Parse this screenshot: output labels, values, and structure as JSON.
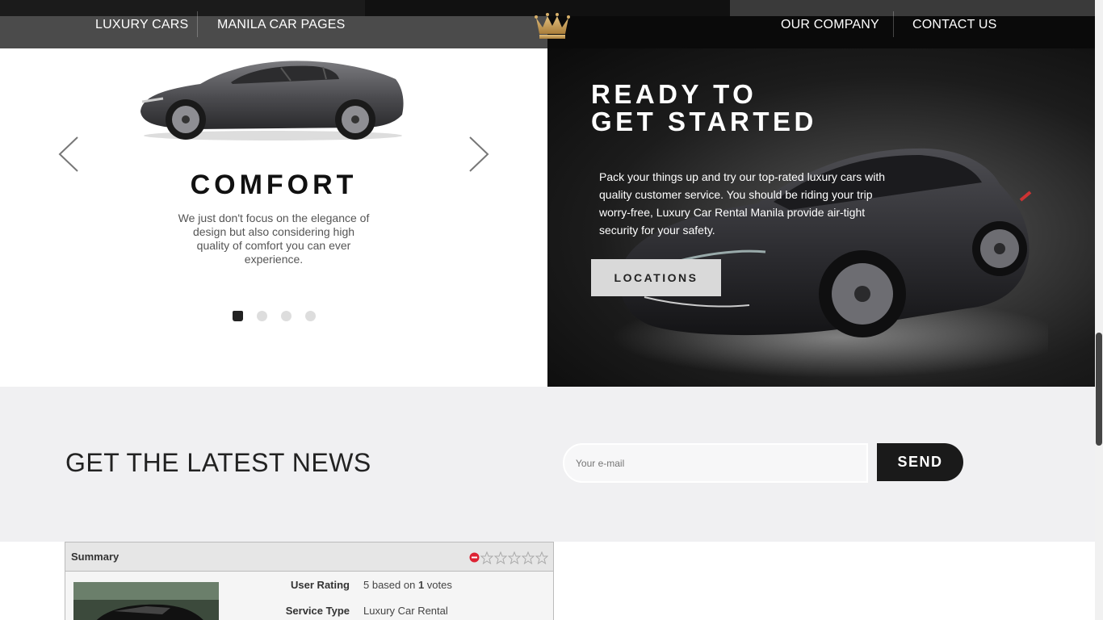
{
  "nav": {
    "left_links": [
      "LUXURY CARS",
      "MANILA CAR PAGES"
    ],
    "right_links": [
      "OUR COMPANY",
      "CONTACT US"
    ],
    "logo_icon": "crown-icon"
  },
  "slider": {
    "title": "COMFORT",
    "text": "We just don't focus on the elegance of design but also considering high quality of comfort you can ever experience.",
    "prev_icon": "chevron-left-icon",
    "next_icon": "chevron-right-icon",
    "dot_count": 4,
    "active_dot": 1
  },
  "promo": {
    "title_line1": "READY TO",
    "title_line2": "GET STARTED",
    "text": "Pack your things up and try our top-rated luxury cars with quality customer service. You should be riding your trip worry-free, Luxury Car Rental Manila provide air-tight security for your safety.",
    "button_label": "LOCATIONS"
  },
  "newsletter": {
    "title": "GET THE LATEST NEWS",
    "email_placeholder": "Your e-mail",
    "send_label": "SEND"
  },
  "summary": {
    "header": "Summary",
    "rating_value": 0,
    "rating_max": 5,
    "fields": [
      {
        "label": "User Rating",
        "value_prefix": "5 based on ",
        "value_bold": "1",
        "value_suffix": " votes"
      },
      {
        "label": "Service Type",
        "value": "Luxury Car Rental"
      }
    ]
  },
  "colors": {
    "nav_dark": "#0a0a0a",
    "nav_gray": "#3c3c3c",
    "accent_gold": "#c9a25c",
    "newsletter_bg": "#f0f0f2",
    "button_dark": "#1a1a1a"
  }
}
